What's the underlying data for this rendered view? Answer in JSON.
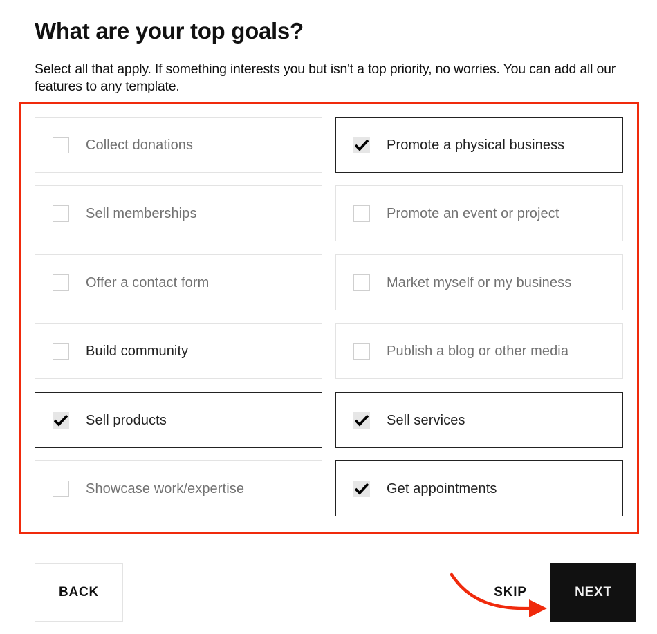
{
  "header": {
    "title": "What are your top goals?",
    "subtitle": "Select all that apply. If something interests you but isn't a top priority, no worries. You can add all our features to any template."
  },
  "goals": [
    {
      "label": "Collect donations",
      "checked": false,
      "emphasis": false
    },
    {
      "label": "Promote a physical business",
      "checked": true,
      "emphasis": false
    },
    {
      "label": "Sell memberships",
      "checked": false,
      "emphasis": false
    },
    {
      "label": "Promote an event or project",
      "checked": false,
      "emphasis": false
    },
    {
      "label": "Offer a contact form",
      "checked": false,
      "emphasis": false
    },
    {
      "label": "Market myself or my business",
      "checked": false,
      "emphasis": false
    },
    {
      "label": "Build community",
      "checked": false,
      "emphasis": true
    },
    {
      "label": "Publish a blog or other media",
      "checked": false,
      "emphasis": false
    },
    {
      "label": "Sell products",
      "checked": true,
      "emphasis": false
    },
    {
      "label": "Sell services",
      "checked": true,
      "emphasis": false
    },
    {
      "label": "Showcase work/expertise",
      "checked": false,
      "emphasis": false
    },
    {
      "label": "Get appointments",
      "checked": true,
      "emphasis": false
    }
  ],
  "footer": {
    "back_label": "BACK",
    "skip_label": "SKIP",
    "next_label": "NEXT"
  },
  "annotation": {
    "highlight_color": "#f02a0c",
    "arrow_icon": "curved-arrow-icon",
    "arrow_target": "NEXT"
  },
  "colors": {
    "checked_border": "#222222",
    "unchecked_border": "#e3e3e3",
    "next_background": "#111111"
  }
}
